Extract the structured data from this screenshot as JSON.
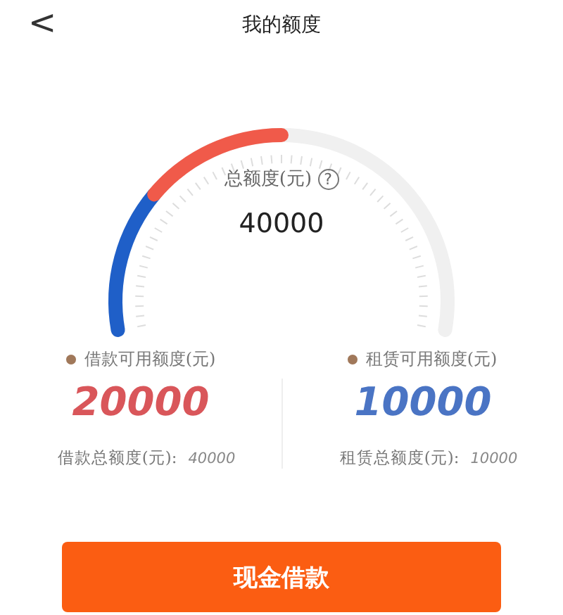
{
  "header": {
    "back": "<",
    "title": "我的额度"
  },
  "gauge": {
    "label": "总额度(元)",
    "help": "?",
    "total": "40000",
    "segments": [
      {
        "color": "#1f5fc8",
        "level": 0.25
      },
      {
        "color": "#f05a4a",
        "level": 0.25
      }
    ]
  },
  "legend": [
    {
      "label": "借款可用额度(元)",
      "color": "#a0785a"
    },
    {
      "label": "租赁可用额度(元)",
      "color": "#a0785a"
    }
  ],
  "amounts": [
    {
      "value": "20000",
      "color": "#d9565a",
      "caption": "借款总额度(元):",
      "caption_value": "40000"
    },
    {
      "value": "10000",
      "color": "#4a74c4",
      "caption": "租赁总额度(元):",
      "caption_value": "10000"
    }
  ],
  "button": "现金借款"
}
